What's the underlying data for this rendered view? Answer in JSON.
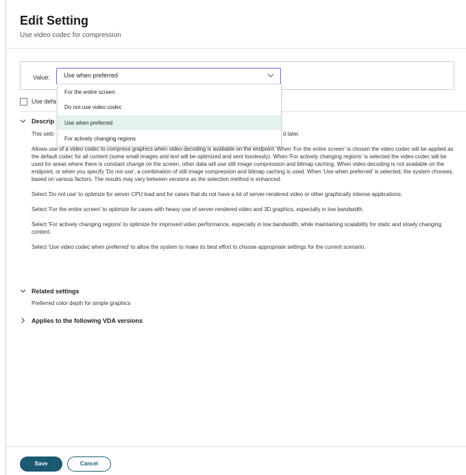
{
  "dialog": {
    "title": "Edit Setting",
    "subtitle": "Use video codec for compression"
  },
  "value_field": {
    "label": "Value:",
    "selected": "Use when preferred",
    "options": [
      "For the entire screen",
      "Do not use video codec",
      "Use when preferred",
      "For actively changing regions"
    ]
  },
  "checkbox": {
    "label_visible": "Use defa",
    "checked": false
  },
  "description": {
    "title_visible": "Descrip",
    "first_line_start": "This setti",
    "first_line_end": "d later.",
    "paragraphs": [
      "Allows use of a video codec to compress graphics when video decoding is available on the endpoint. When 'For the entire screen' is chosen the video codec will be applied as the default codec for all content (some small images and text will be optimized and sent losslessly). When 'For actively changing regions' is selected the video codec will be used for areas where there is constant change on the screen, other data will use still image compression and bitmap caching. When video decoding is not available on the endpoint, or when you specify 'Do not use', a combination of still image compression and bitmap caching is used. When 'Use when preferred' is selected, the system chooses, based on various factors. The results may vary between versions as the selection method is enhanced.",
      "Select 'Do not use' to optimize for server CPU load and for cases that do not have a lot of server-rendered video or other graphically intense applications.",
      "Select 'For the entire screen' to optimize for cases with heavy use of server-rendered video and 3D graphics, especially in low bandwidth.",
      "Select 'For actively changing regions' to optimize for improved video performance, especially in low bandwidth, while maintaining scalability for static and slowly changing content.",
      "Select 'Use video codec when preferred' to allow the system to make its best effort to choose appropriate settings for the current scenario."
    ]
  },
  "related": {
    "title": "Related settings",
    "item": "Preferred color depth for simple graphics"
  },
  "applies": {
    "title": "Applies to the following VDA versions"
  },
  "footer": {
    "save_label": "Save",
    "cancel_label": "Cancel"
  },
  "colors": {
    "accent_primary": "#1b5a72",
    "select_focus": "#7a5cc2",
    "selected_option_bg": "#e3f2ef"
  },
  "icons": {
    "dropdown": "chevron-down-icon",
    "expanded_section": "chevron-down-icon",
    "collapsed_section": "chevron-right-icon"
  }
}
